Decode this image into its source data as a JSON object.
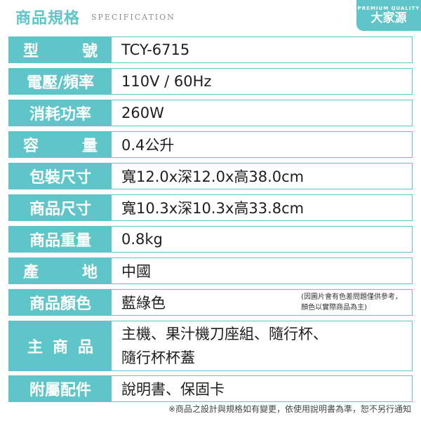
{
  "header": {
    "title": "商品規格",
    "subtitle": "SPECIFICATION",
    "badge_top": "PREMIUM QUALITY",
    "badge_brand": "大家源"
  },
  "specs": [
    {
      "label_a": "型",
      "label_b": "號",
      "value": "TCY-6715"
    },
    {
      "label": "電壓/頻率",
      "value": "110V / 60Hz"
    },
    {
      "label": "消耗功率",
      "value": "260W"
    },
    {
      "label_a": "容",
      "label_b": "量",
      "value": "0.4公升"
    },
    {
      "label": "包裝尺寸",
      "value": "寬12.0x深12.0x高38.0cm"
    },
    {
      "label": "商品尺寸",
      "value": "寬10.3x深10.3x高33.8cm"
    },
    {
      "label": "商品重量",
      "value": "0.8kg"
    },
    {
      "label_a": "產",
      "label_b": "地",
      "value": "中國"
    },
    {
      "label": "商品顏色",
      "value": "藍綠色",
      "note": "(因圖片會有色差問題僅供參考，\n顏色以實際商品為主)"
    },
    {
      "label": "主商品",
      "value_line1": "主機、果汁機刀座組、隨行杯、",
      "value_line2": "隨行杯杯蓋"
    },
    {
      "label": "附屬配件",
      "value": "說明書、保固卡"
    }
  ],
  "footnote": "※商品之設計與規格如有變更，依使用說明書為準，恕不另行通知",
  "colors": {
    "accent": "#5fc5c9",
    "text": "#222222"
  }
}
